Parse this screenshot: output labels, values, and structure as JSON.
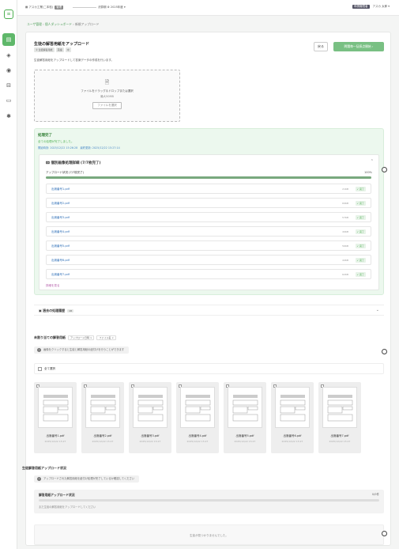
{
  "topbar": {
    "org": "アスカ工業(二本松)",
    "org_badge": "管理",
    "mid_label": "決算期",
    "period": "2025年度",
    "role_badge": "申請権限者",
    "user": "アスカ 太郎"
  },
  "sidebar": {
    "logo": "≡",
    "items": [
      {
        "icon": "document-icon",
        "glyph": "▤",
        "active": true
      },
      {
        "icon": "tag-icon",
        "glyph": "◈",
        "active": false
      },
      {
        "icon": "eye-icon",
        "glyph": "◉",
        "active": false
      },
      {
        "icon": "filter-icon",
        "glyph": "⊟",
        "active": false
      },
      {
        "icon": "card-icon",
        "glyph": "▭",
        "active": false
      },
      {
        "icon": "settings-icon",
        "glyph": "✱",
        "active": false
      }
    ]
  },
  "breadcrumb": {
    "root": "ユーザ管理",
    "parent": "個人ダッシュボード",
    "current": "新規アップロード"
  },
  "header": {
    "title": "生徒の解答用紙をアップロード",
    "tags": [
      "② 生徒解答用紙",
      "英語",
      "中"
    ],
    "back_label": "戻る",
    "next_label": "問題毎一括採点開始 ›"
  },
  "description": "生徒解答用紙をアップロードして答案データの作成を行います。",
  "dropzone": {
    "title": "ファイルをドラッグ＆ドロップまたは選択",
    "sub": "最大50MB",
    "button": "ファイルを選択"
  },
  "result": {
    "title": "処理完了",
    "detail": "全ての処理が完了しました。",
    "meta": "開始時刻: 2025/12/22 15:26:28　最終更新: 2025/12/22 15:27:14",
    "panel_title": "個別画像処理詳細 (7/7枚完了)",
    "progress_label": "アップロード状況 (7/7枚完了)",
    "progress_text": "100%",
    "progress_value": 100,
    "files": [
      {
        "name": "出席番号1.pdf",
        "size": "21KB",
        "status": "完了"
      },
      {
        "name": "出席番号2.pdf",
        "size": "69KB",
        "status": "完了"
      },
      {
        "name": "出席番号3.pdf",
        "size": "57KB",
        "status": "完了"
      },
      {
        "name": "出席番号4.pdf",
        "size": "49KB",
        "status": "完了"
      },
      {
        "name": "出席番号5.pdf",
        "size": "56KB",
        "status": "完了"
      },
      {
        "name": "出席番号6.pdf",
        "size": "44KB",
        "status": "完了"
      },
      {
        "name": "出席番号7.pdf",
        "size": "62KB",
        "status": "完了"
      }
    ],
    "more_label": "詳細を見る"
  },
  "history": {
    "label": "過去の処理履歴",
    "count": "18"
  },
  "unassigned": {
    "title": "未割り当ての解答用紙",
    "chips": [
      "アップロード日時 ×",
      "ファイル名 ×"
    ],
    "info": "画像をクリックすると生徒と解答用紙の紐付けを行うことができます",
    "select_all": "全て選択",
    "thumbs": [
      {
        "name": "出席番号1.pdf",
        "date": "2025/12/22 15:27"
      },
      {
        "name": "出席番号2.pdf",
        "date": "2025/12/22 15:27"
      },
      {
        "name": "出席番号3.pdf",
        "date": "2025/12/22 15:27"
      },
      {
        "name": "出席番号4.pdf",
        "date": "2025/12/22 15:27"
      },
      {
        "name": "出席番号5.pdf",
        "date": "2025/12/22 15:27"
      },
      {
        "name": "出席番号6.pdf",
        "date": "2025/12/22 15:27"
      },
      {
        "name": "出席番号7.pdf",
        "date": "2025/12/22 15:27"
      }
    ]
  },
  "upload_status": {
    "title": "生徒解答用紙アップロード状況",
    "info": "アップロードされた解答用紙を紐付け処理が完了しているか確認してください",
    "bar_label": "解答用紙アップロード状況",
    "bar_value": "0/0件",
    "note": "まだ生徒の解答用紙をアップロードしてください",
    "empty": "生徒が見つかりませんでした。"
  }
}
